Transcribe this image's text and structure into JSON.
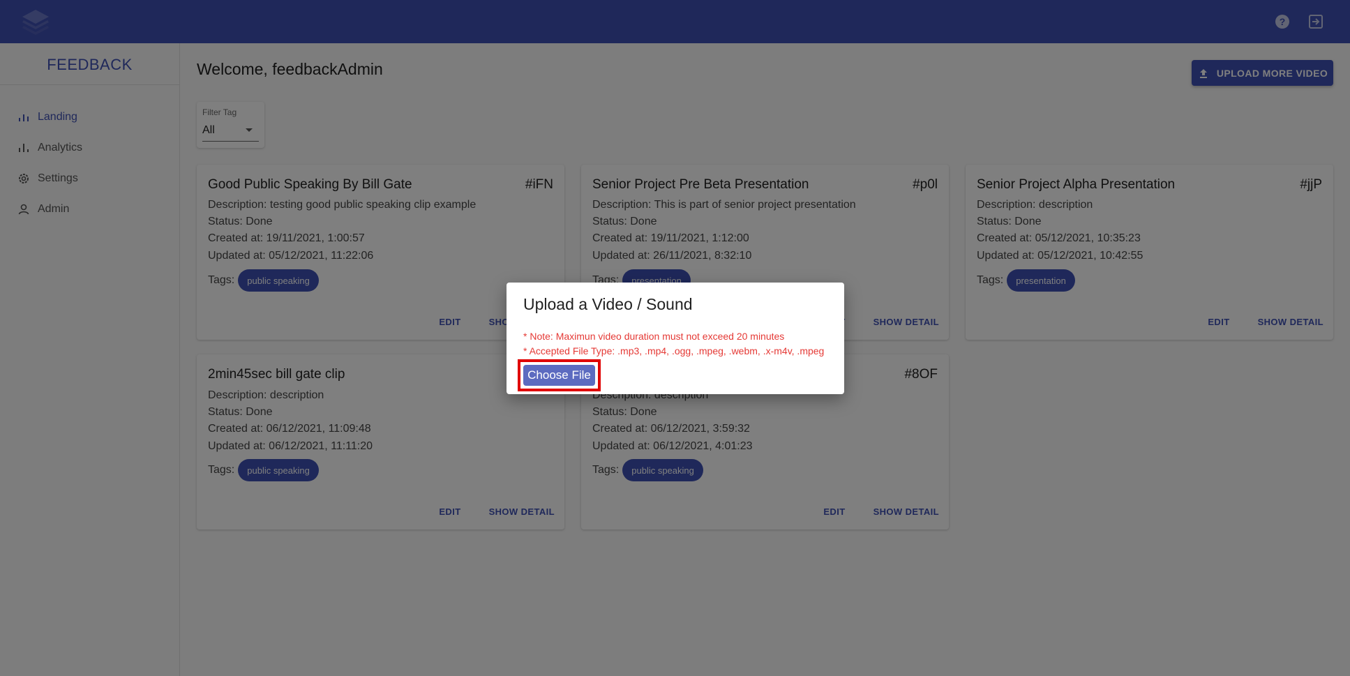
{
  "app": {
    "brand": "FEEDBACK"
  },
  "sidebar": {
    "items": [
      {
        "label": "Landing",
        "icon": "bar-chart-icon"
      },
      {
        "label": "Analytics",
        "icon": "bar-chart-icon"
      },
      {
        "label": "Settings",
        "icon": "gear-icon"
      },
      {
        "label": "Admin",
        "icon": "person-icon"
      }
    ]
  },
  "main": {
    "welcome": "Welcome, feedbackAdmin",
    "upload_more_label": "UPLOAD MORE VIDEO",
    "filter": {
      "label": "Filter Tag",
      "value": "All"
    },
    "card_actions": {
      "edit": "EDIT",
      "show_detail": "SHOW DETAIL"
    },
    "cards": [
      {
        "title": "Good Public Speaking By Bill Gate",
        "id": "#iFN",
        "description": "Description: testing good public speaking clip example",
        "status": "Status: Done",
        "created": "Created at: 19/11/2021, 1:00:57",
        "updated": "Updated at: 05/12/2021, 11:22:06",
        "tags_label": "Tags:",
        "tag": "public speaking"
      },
      {
        "title": "Senior Project Pre Beta Presentation",
        "id": "#p0l",
        "description": "Description: This is part of senior project presentation",
        "status": "Status: Done",
        "created": "Created at: 19/11/2021, 1:12:00",
        "updated": "Updated at: 26/11/2021, 8:32:10",
        "tags_label": "Tags:",
        "tag": "presentation"
      },
      {
        "title": "Senior Project Alpha Presentation",
        "id": "#jjP",
        "description": "Description: description",
        "status": "Status: Done",
        "created": "Created at: 05/12/2021, 10:35:23",
        "updated": "Updated at: 05/12/2021, 10:42:55",
        "tags_label": "Tags:",
        "tag": "presentation"
      },
      {
        "title": "2min45sec bill gate clip",
        "id": "",
        "description": "Description: description",
        "status": "Status: Done",
        "created": "Created at: 06/12/2021, 11:09:48",
        "updated": "Updated at: 06/12/2021, 11:11:20",
        "tags_label": "Tags:",
        "tag": "public speaking"
      },
      {
        "title": "",
        "id": "#8OF",
        "description": "Description: description",
        "status": "Status: Done",
        "created": "Created at: 06/12/2021, 3:59:32",
        "updated": "Updated at: 06/12/2021, 4:01:23",
        "tags_label": "Tags:",
        "tag": "public speaking"
      }
    ]
  },
  "dialog": {
    "title": "Upload a Video / Sound",
    "note_duration": "* Note: Maximun video duration must not exceed 20 minutes",
    "note_types": "* Accepted File Type: .mp3, .mp4, .ogg, .mpeg, .webm, .x-m4v, .mpeg",
    "choose_file_label": "Choose File"
  },
  "colors": {
    "primary": "#3f51b5",
    "note_red": "#e53935",
    "highlight": "#e00000"
  }
}
